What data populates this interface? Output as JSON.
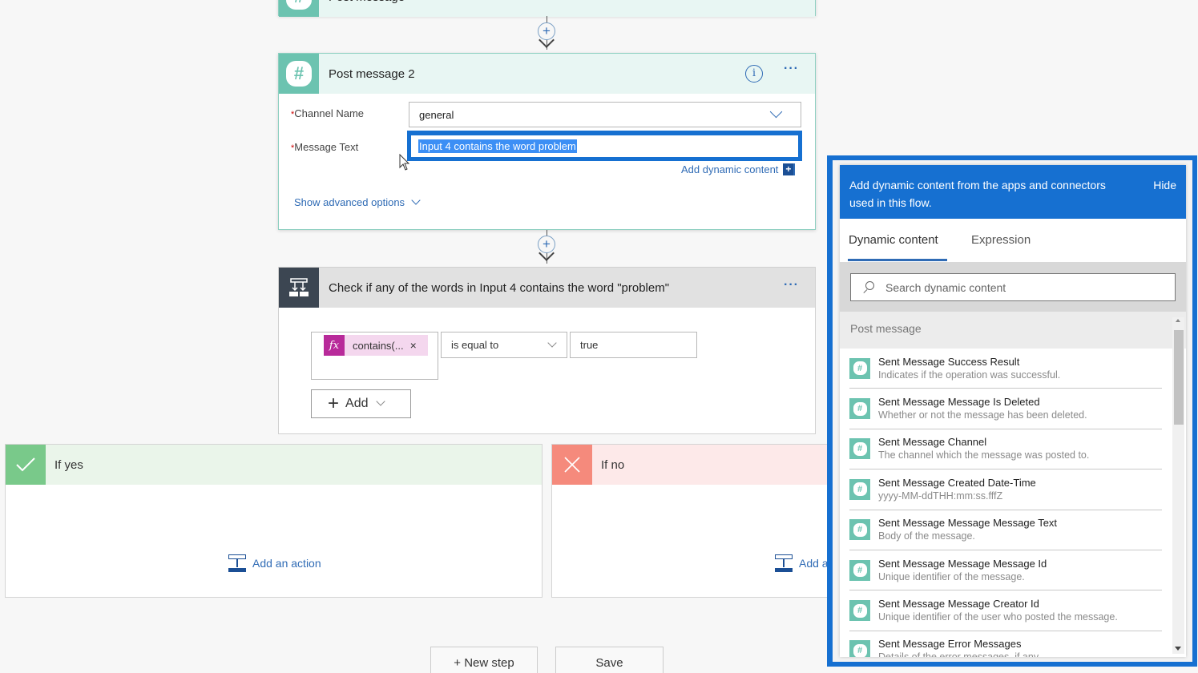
{
  "top_card": {
    "title": "Post message"
  },
  "post_message_2": {
    "title": "Post message 2",
    "info_icon": "info-icon",
    "more_icon": "ellipsis-icon",
    "channel_label": "Channel Name",
    "channel_value": "general",
    "message_label": "Message Text",
    "message_value": "Input 4 contains the word problem",
    "required_mark": "*",
    "add_dynamic": "Add dynamic content",
    "add_dynamic_plus": "+",
    "show_advanced": "Show advanced options"
  },
  "condition": {
    "title": "Check if any of the words in Input 4 contains the word \"problem\"",
    "more": "···",
    "token_fx": "fx",
    "token_text": "contains(...",
    "token_remove": "×",
    "operator": "is equal to",
    "value": "true",
    "add_label": "Add"
  },
  "branches": {
    "yes": {
      "title": "If yes",
      "add_action": "Add an action",
      "icon": "checkmark-icon"
    },
    "no": {
      "title": "If no",
      "add_action": "Add an action",
      "icon": "close-icon"
    }
  },
  "bottom": {
    "new_step": "+ New step",
    "save": "Save"
  },
  "dynamic_panel": {
    "header_text": "Add dynamic content from the apps and connectors used in this flow.",
    "hide": "Hide",
    "tabs": [
      {
        "label": "Dynamic content",
        "active": true
      },
      {
        "label": "Expression",
        "active": false
      }
    ],
    "search_placeholder": "Search dynamic content",
    "group": "Post message",
    "items": [
      {
        "title": "Sent Message Success Result",
        "desc": "Indicates if the operation was successful."
      },
      {
        "title": "Sent Message Message Is Deleted",
        "desc": "Whether or not the message has been deleted."
      },
      {
        "title": "Sent Message Channel",
        "desc": "The channel which the message was posted to."
      },
      {
        "title": "Sent Message Created Date-Time",
        "desc": "yyyy-MM-ddTHH:mm:ss.fffZ"
      },
      {
        "title": "Sent Message Message Message Text",
        "desc": "Body of the message."
      },
      {
        "title": "Sent Message Message Message Id",
        "desc": "Unique identifier of the message."
      },
      {
        "title": "Sent Message Message Creator Id",
        "desc": "Unique identifier of the user who posted the message."
      },
      {
        "title": "Sent Message Error Messages",
        "desc": "Details of the error messages, if any."
      }
    ]
  },
  "colors": {
    "accent": "#1670d1",
    "slack_teal": "#6cc3b0",
    "condition_dark": "#3c4652",
    "yes_green": "#79c98a",
    "no_red": "#f58a7c",
    "expression_magenta": "#b82a9a"
  }
}
